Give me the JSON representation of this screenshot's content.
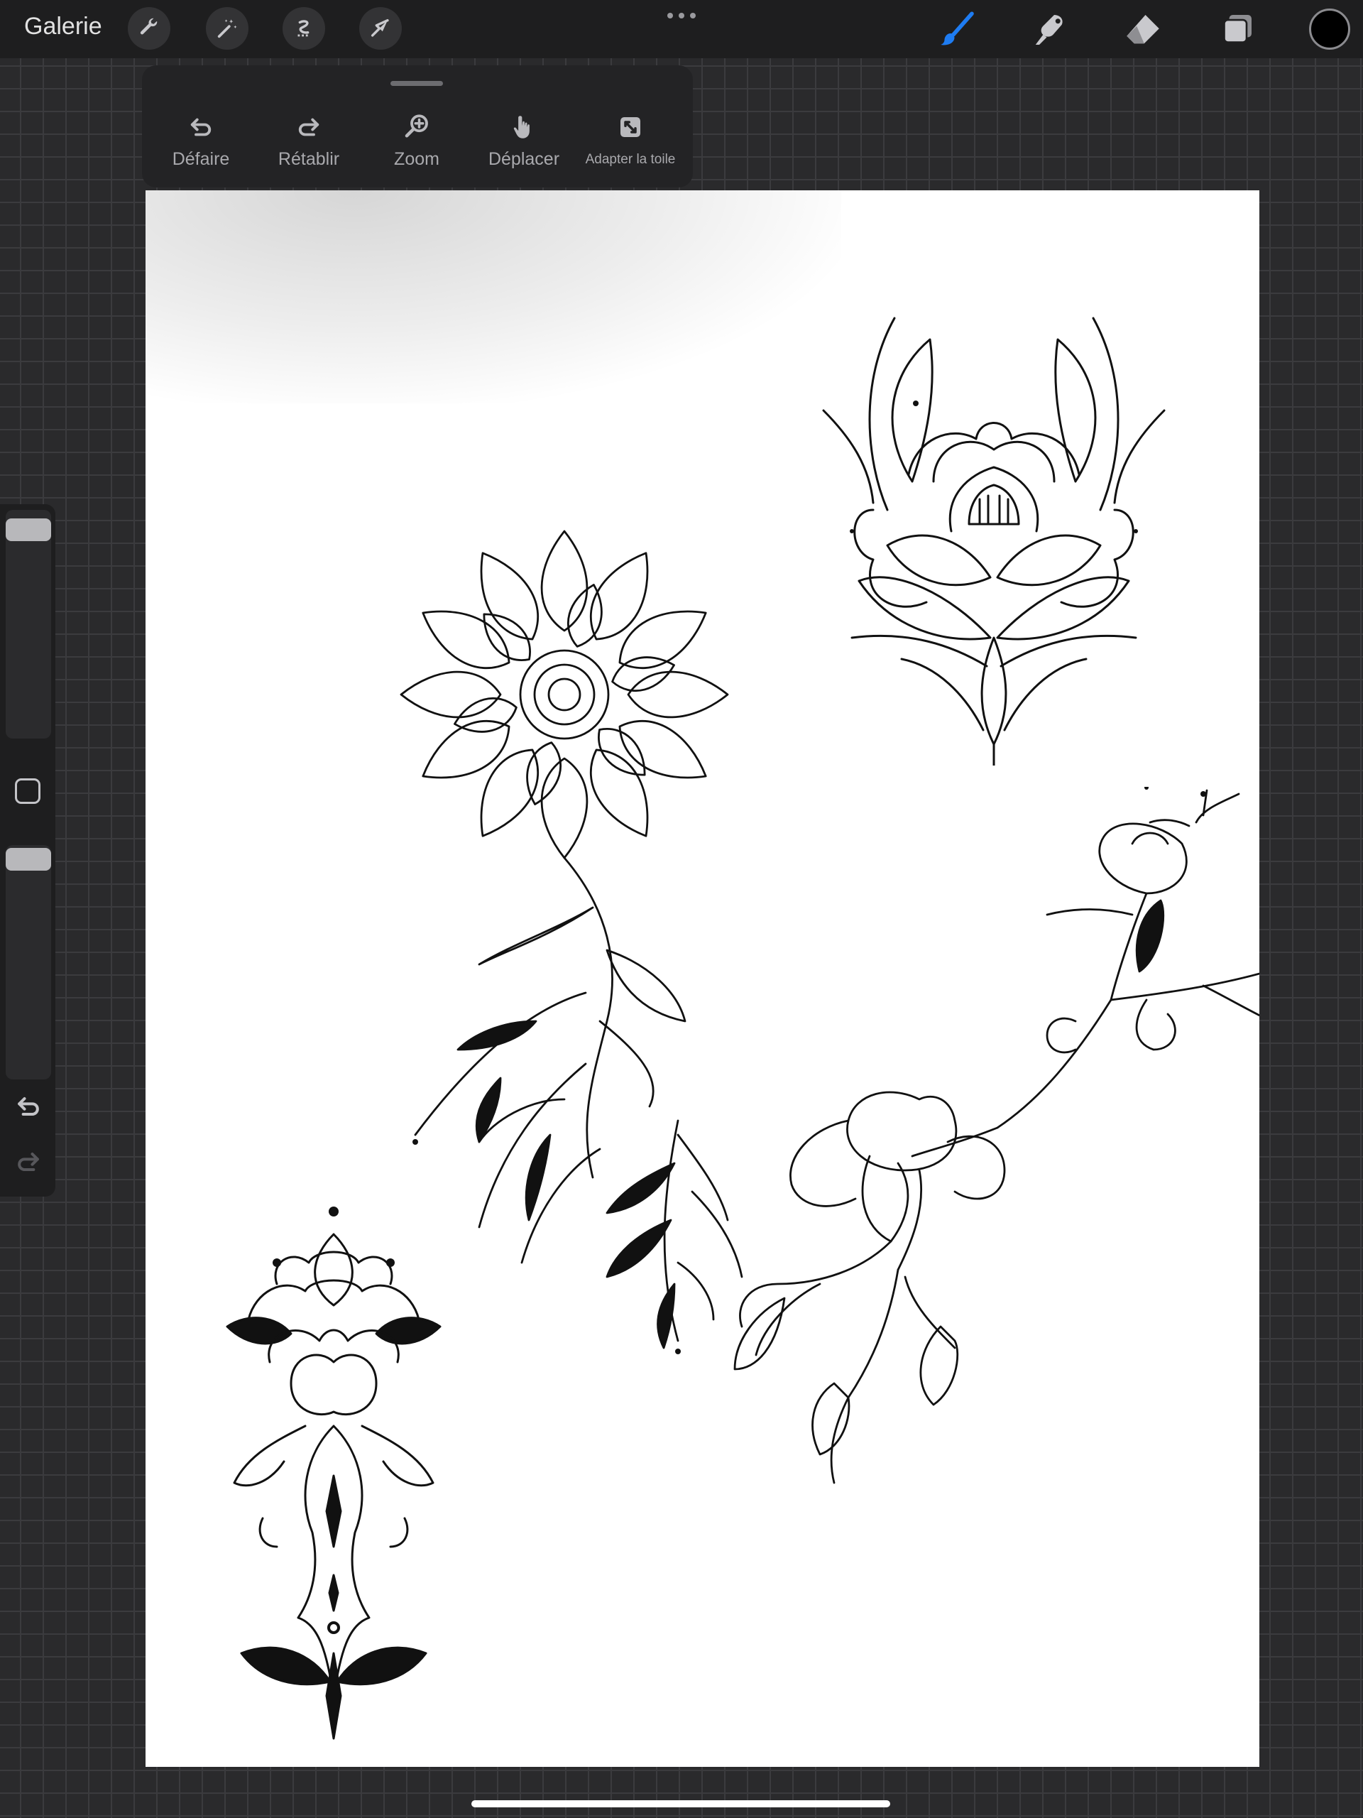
{
  "topbar": {
    "gallery_label": "Galerie",
    "left_tools": [
      "wrench-icon",
      "magic-wand-icon",
      "selection-icon",
      "transform-arrow-icon"
    ],
    "right_tools": [
      "brush-icon",
      "smudge-icon",
      "eraser-icon",
      "layers-icon"
    ],
    "active_tool": "brush-icon",
    "active_color": "#1e7cf2",
    "current_color": "#000000"
  },
  "quick_menu": {
    "undo_label": "Défaire",
    "redo_label": "Rétablir",
    "zoom_label": "Zoom",
    "move_label": "Déplacer",
    "fit_label": "Adapter la toile"
  },
  "sidebar": {
    "brush_size": 0.95,
    "brush_opacity": 0.97
  },
  "canvas": {
    "background": "#ffffff",
    "artwork": [
      "dahlia-flower-drawing",
      "lotus-flower-drawing",
      "cherry-blossom-branch-drawing",
      "ornamental-lotus-drawing"
    ]
  }
}
